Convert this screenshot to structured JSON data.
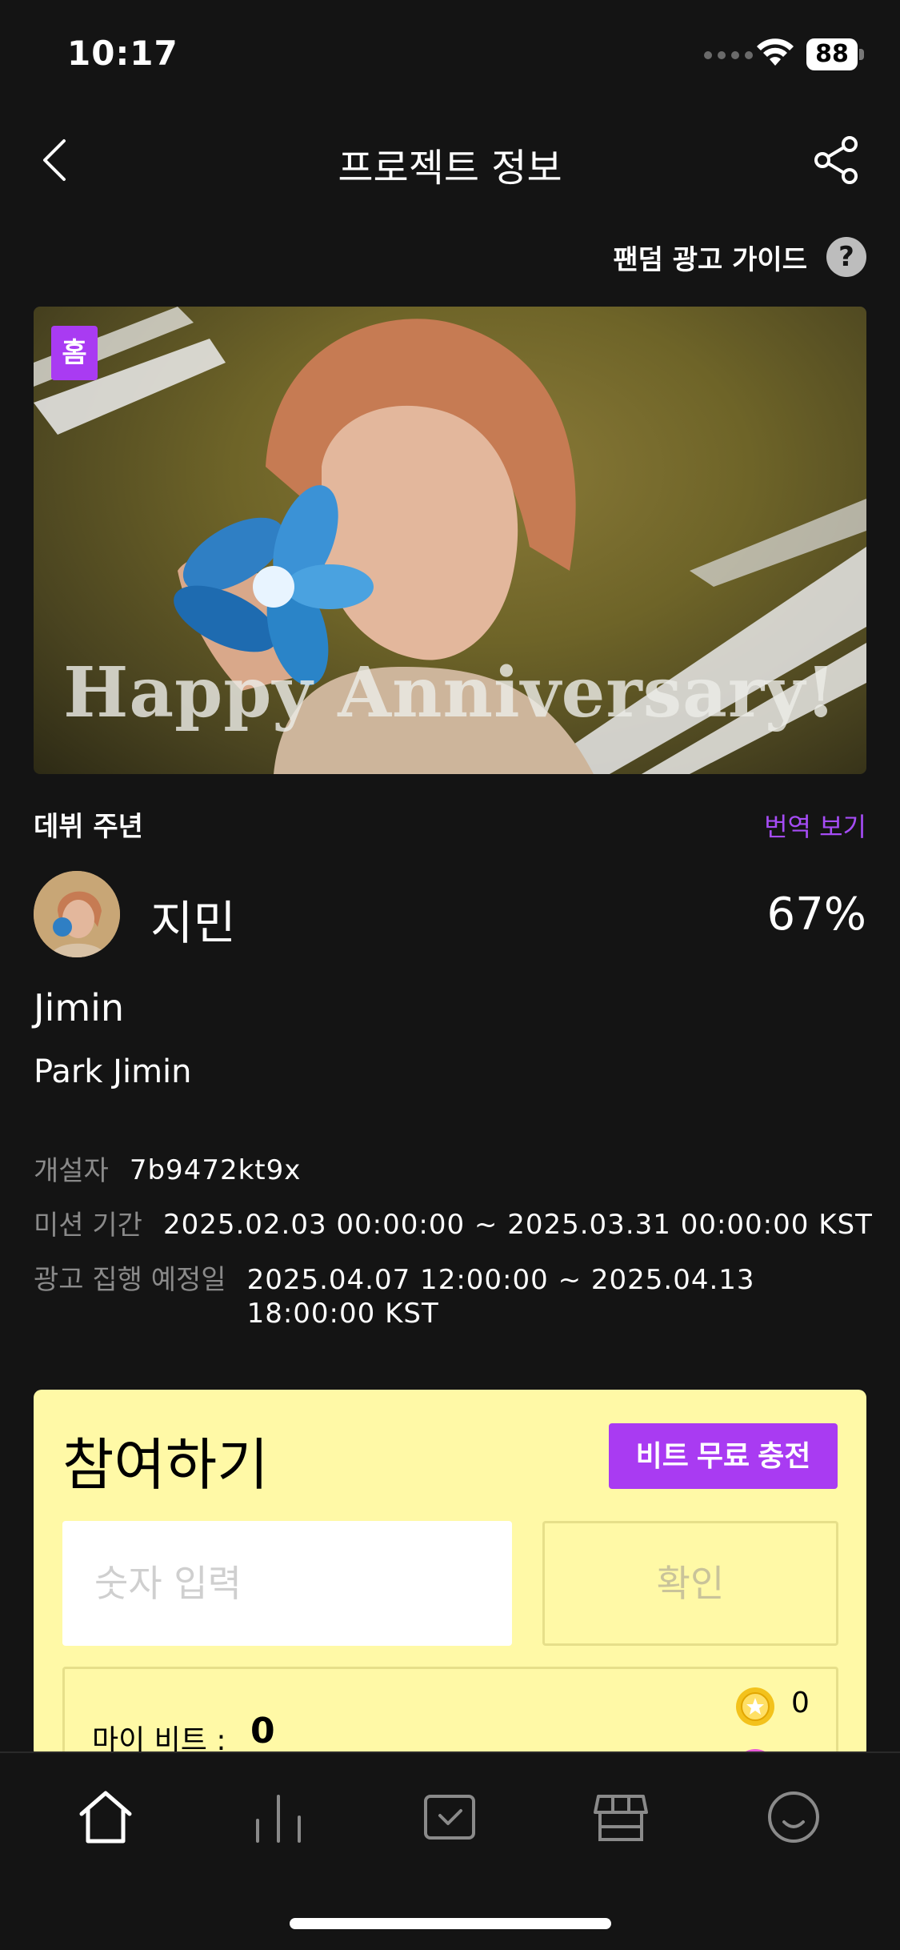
{
  "status_bar": {
    "time": "10:17",
    "battery": "88"
  },
  "header": {
    "title": "프로젝트 정보"
  },
  "guide": {
    "label": "팬덤 광고 가이드",
    "help_symbol": "?"
  },
  "banner": {
    "badge": "홈",
    "text": "Happy Anniversary!"
  },
  "project": {
    "name": "데뷔 주년",
    "translate_label": "번역 보기",
    "artist_name": "지민",
    "progress_percent": "67%",
    "english_name": "Jimin",
    "full_name": "Park Jimin"
  },
  "info": {
    "creator_label": "개설자",
    "creator_value": "7b9472kt9x",
    "mission_label": "미션 기간",
    "mission_value": "2025.02.03 00:00:00 ~ 2025.03.31 00:00:00 KST",
    "ad_label": "광고 집행 예정일",
    "ad_value": "2025.04.07 12:00:00 ~ 2025.04.13 18:00:00 KST"
  },
  "participate": {
    "title": "참여하기",
    "charge_button": "비트 무료 충전",
    "input_placeholder": "숫자 입력",
    "confirm_button": "확인",
    "my_bits_label": "마이 비트 :",
    "my_bits_value": "0",
    "coin_count": "0"
  },
  "nav": {
    "items": [
      {
        "icon": "home-icon"
      },
      {
        "icon": "chart-icon"
      },
      {
        "icon": "inbox-icon"
      },
      {
        "icon": "store-icon"
      },
      {
        "icon": "smile-icon"
      }
    ]
  },
  "colors": {
    "accent": "#a93bf2",
    "card_background": "#fff9a6",
    "background": "#141414"
  }
}
